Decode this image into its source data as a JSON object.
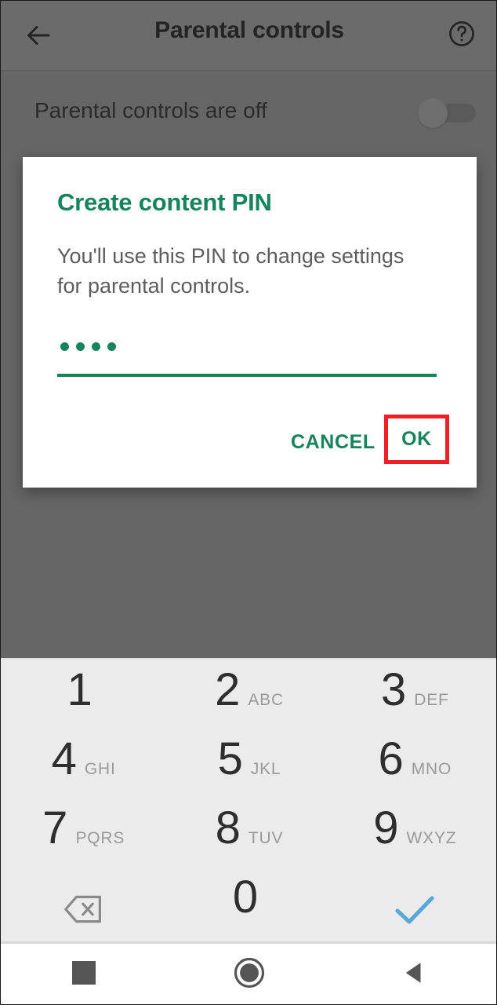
{
  "appbar": {
    "back_icon": "arrow-left-icon",
    "title": "Parental controls",
    "help_icon": "help-circle-icon"
  },
  "settings_row": {
    "label": "Parental controls are off",
    "toggle_state": "off"
  },
  "dialog": {
    "title": "Create content PIN",
    "message": "You'll use this PIN to change settings for parental controls.",
    "pin_input": {
      "value": "••••",
      "digit_count": 4,
      "masked": true
    },
    "cancel_label": "CANCEL",
    "ok_label": "OK",
    "accent_color": "#15835c",
    "highlight_color": "#f01f28"
  },
  "keypad": {
    "rows": [
      [
        {
          "digit": "1",
          "letters": ""
        },
        {
          "digit": "2",
          "letters": "ABC"
        },
        {
          "digit": "3",
          "letters": "DEF"
        }
      ],
      [
        {
          "digit": "4",
          "letters": "GHI"
        },
        {
          "digit": "5",
          "letters": "JKL"
        },
        {
          "digit": "6",
          "letters": "MNO"
        }
      ],
      [
        {
          "digit": "7",
          "letters": "PQRS"
        },
        {
          "digit": "8",
          "letters": "TUV"
        },
        {
          "digit": "9",
          "letters": "WXYZ"
        }
      ]
    ],
    "last_row": {
      "backspace_icon": "backspace-icon",
      "zero": {
        "digit": "0",
        "letters": ""
      },
      "confirm_icon": "checkmark-icon",
      "confirm_color": "#5aa8d8"
    },
    "background_color": "#ebebeb"
  },
  "navbar": {
    "recents_icon": "square-recents-icon",
    "home_icon": "circle-home-icon",
    "back_icon": "triangle-back-icon"
  },
  "colors": {
    "scrim": "#666666",
    "appbar": "#6b6b6b",
    "dialog_bg": "#ffffff"
  }
}
